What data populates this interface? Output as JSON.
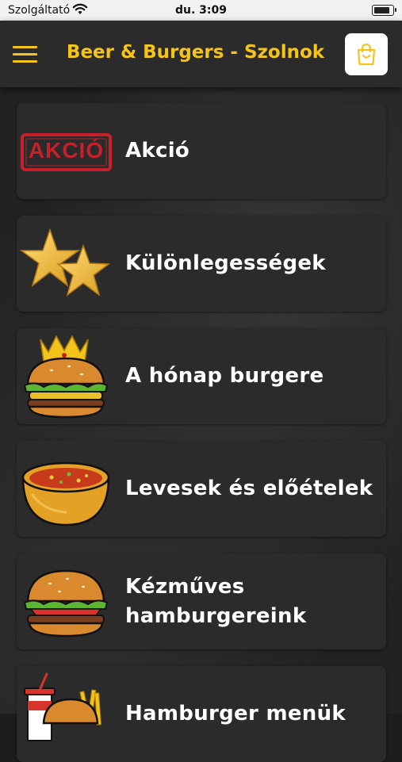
{
  "status_bar": {
    "carrier": "Szolgáltató",
    "time": "du. 3:09"
  },
  "header": {
    "title": "Beer & Burgers - Szolnok",
    "menu_icon": "hamburger-menu-icon",
    "cart_icon": "shopping-bag-icon",
    "accent_color": "#f5c41a"
  },
  "badge_text": "AKCIÓ",
  "categories": [
    {
      "label": "Akció",
      "icon": "akcio-stamp-icon"
    },
    {
      "label": "Különlegességek",
      "icon": "gold-stars-icon"
    },
    {
      "label": "A hónap burgere",
      "icon": "crowned-burger-icon"
    },
    {
      "label": "Levesek és előételek",
      "icon": "soup-bowl-icon"
    },
    {
      "label": "Kézműves hamburgereink",
      "icon": "burger-icon"
    },
    {
      "label": "Hamburger menük",
      "icon": "burger-menu-combo-icon"
    }
  ]
}
